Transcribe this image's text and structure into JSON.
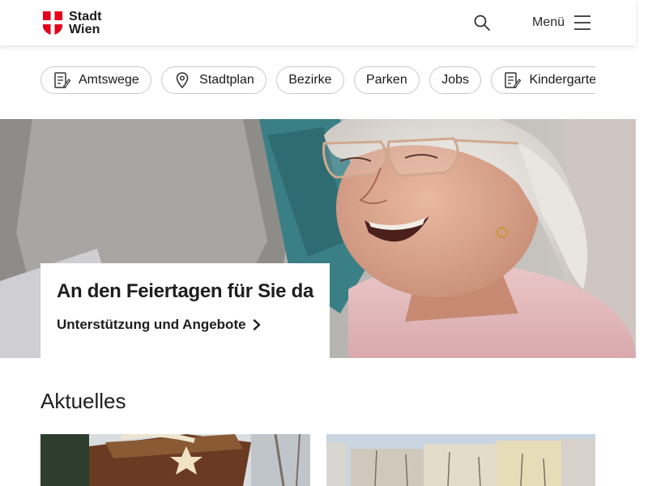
{
  "header": {
    "logo_line1": "Stadt",
    "logo_line2": "Wien",
    "menu_label": "Menü",
    "brand_red": "#e2001a"
  },
  "quicklinks": [
    {
      "label": "Amtswege",
      "icon": "form-icon"
    },
    {
      "label": "Stadtplan",
      "icon": "map-pin-icon"
    },
    {
      "label": "Bezirke",
      "icon": ""
    },
    {
      "label": "Parken",
      "icon": ""
    },
    {
      "label": "Jobs",
      "icon": ""
    },
    {
      "label": "Kindergarten",
      "icon": "form-icon"
    }
  ],
  "hero": {
    "title": "An den Feiertagen für Sie da",
    "link_label": "Unterstützung und Angebote",
    "image": "smiling-elderly-woman-photo"
  },
  "news": {
    "section_title": "Aktuelles",
    "items": [
      {
        "image": "christmas-market-stall-photo"
      },
      {
        "image": "city-buildings-park-photo"
      }
    ]
  }
}
